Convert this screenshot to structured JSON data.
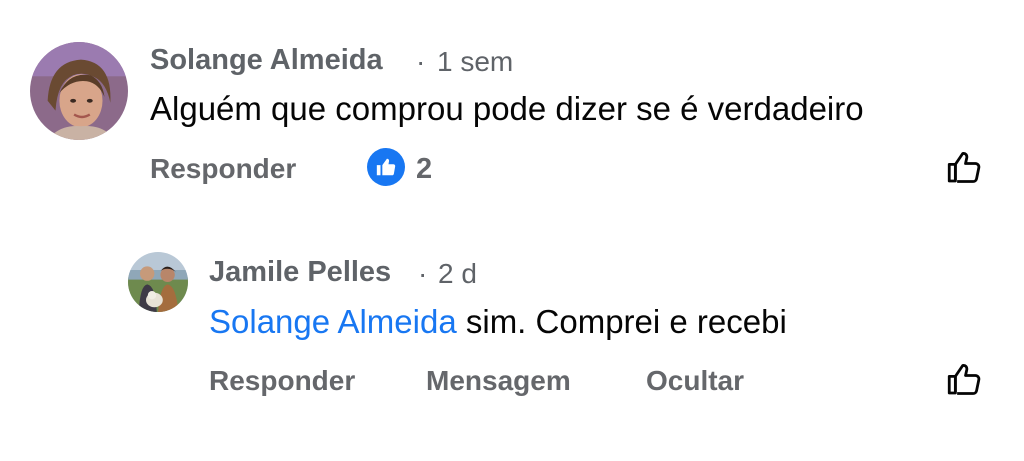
{
  "comments": [
    {
      "author": "Solange Almeida",
      "separator": "·",
      "time": "1 sem",
      "text": "Alguém que comprou pode dizer se é verdadeiro",
      "actions": {
        "reply": "Responder"
      },
      "reactions": {
        "icon": "like-icon",
        "count": "2"
      }
    }
  ],
  "reply": {
    "author": "Jamile Pelles",
    "separator": "·",
    "time": "2 d",
    "mention": "Solange Almeida",
    "text": "sim. Comprei e recebi",
    "actions": {
      "reply": "Responder",
      "message": "Mensagem",
      "hide": "Ocultar"
    }
  },
  "colors": {
    "accent": "#1877f2",
    "muted_text": "#65676b",
    "body_text": "#050505"
  }
}
